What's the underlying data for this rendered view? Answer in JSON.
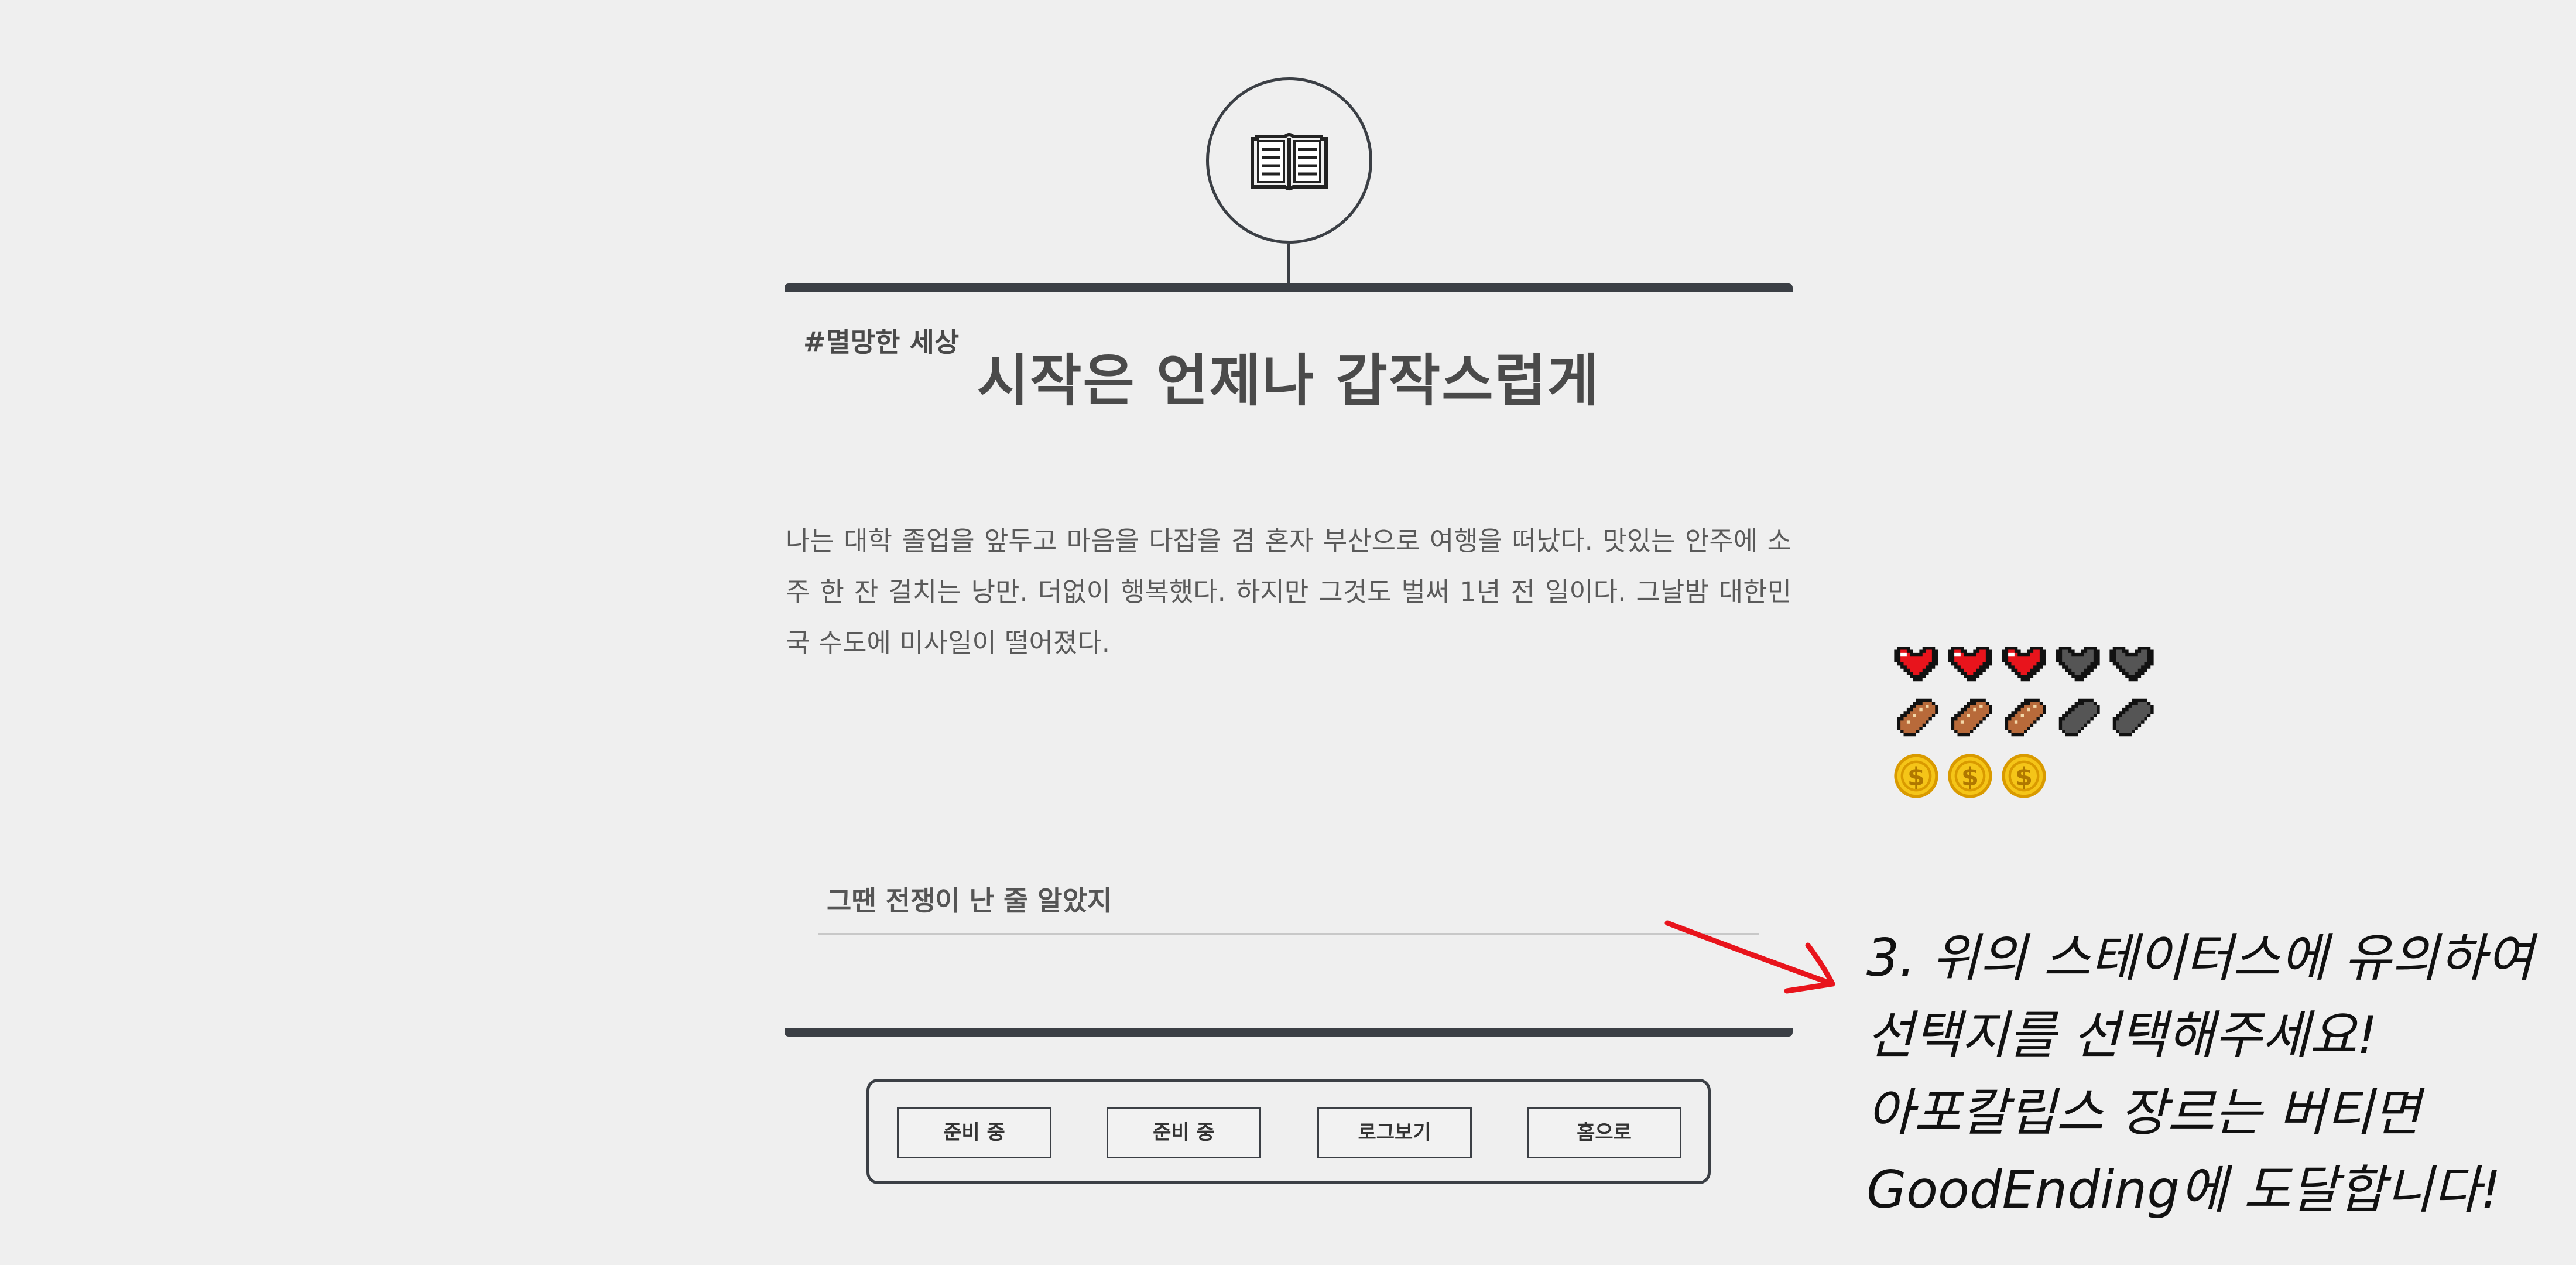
{
  "story": {
    "tag": "#멸망한 세상",
    "title": "시작은 언제나 갑작스럽게",
    "text": "나는 대학 졸업을 앞두고 마음을 다잡을 겸 혼자 부산으로 여행을 떠났다. 맛있는 안주에 소주 한 잔 걸치는 낭만. 더없이 행복했다. 하지만 그것도 벌써 1년 전 일이다. 그날밤 대한민국 수도에 미사일이 떨어졌다."
  },
  "choices": [
    {
      "label": "그땐 전쟁이 난 줄 알았지"
    }
  ],
  "menu": {
    "btn1": "준비 중",
    "btn2": "준비 중",
    "btn3": "로그보기",
    "btn4": "홈으로"
  },
  "status": {
    "health": {
      "icon": "heart-icon",
      "value": 3,
      "max": 5,
      "color": "#e8141c"
    },
    "food": {
      "icon": "bread-icon",
      "value": 3,
      "max": 5,
      "color": "#b86a3a"
    },
    "money": {
      "icon": "coin-icon",
      "value": 3,
      "color": "#f5c518"
    }
  },
  "annotation": {
    "line1": "3. 위의 스테이터스에 유의하여",
    "line2": "선택지를 선택해주세요!",
    "line3": "아포칼립스 장르는 버티면",
    "line4": "GoodEnding에 도달합니다!",
    "arrow_color": "#e8141c"
  }
}
